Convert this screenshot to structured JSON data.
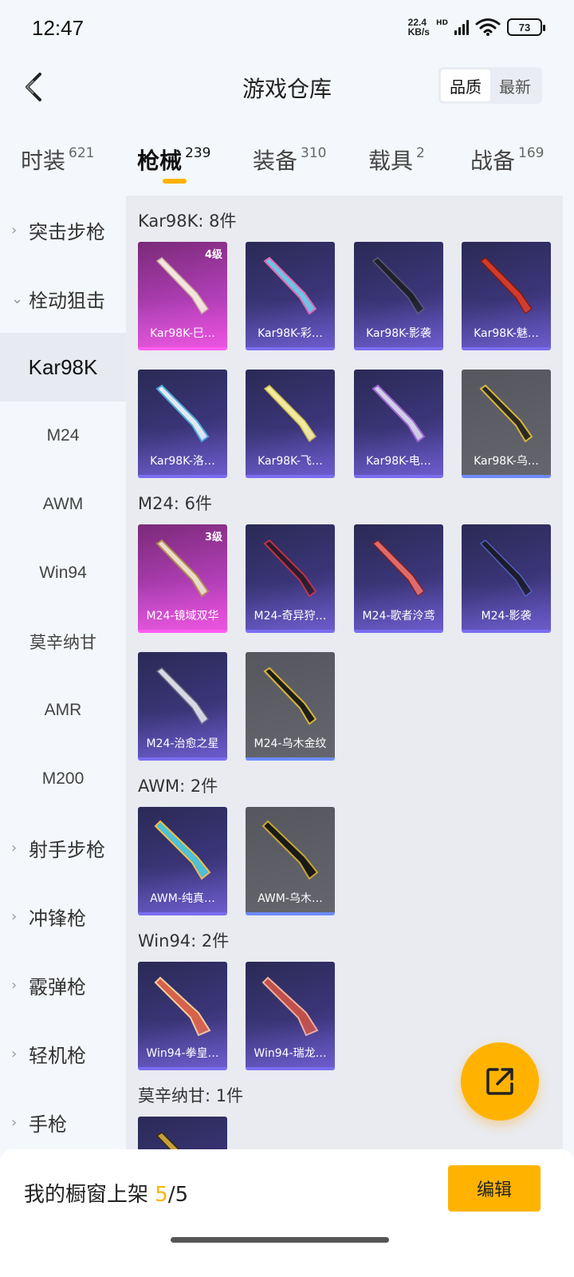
{
  "status": {
    "time": "12:47",
    "net_speed": "22.4",
    "net_unit": "KB/s",
    "hd": "HD",
    "battery": "73"
  },
  "header": {
    "title": "游戏仓库",
    "sort": [
      "品质",
      "最新"
    ]
  },
  "tabs": [
    {
      "label": "时装",
      "count": "621"
    },
    {
      "label": "枪械",
      "count": "239"
    },
    {
      "label": "装备",
      "count": "310"
    },
    {
      "label": "载具",
      "count": "2"
    },
    {
      "label": "战备",
      "count": "169"
    }
  ],
  "sidebar": {
    "groups": [
      "突击步枪",
      "栓动狙击",
      "射手步枪",
      "冲锋枪",
      "霰弹枪",
      "轻机枪",
      "手枪"
    ],
    "subs": [
      "Kar98K",
      "M24",
      "AWM",
      "Win94",
      "莫辛纳甘",
      "AMR",
      "M200"
    ]
  },
  "sections": [
    {
      "title": "Kar98K: 8件",
      "items": [
        {
          "label": "Kar98K-巳…",
          "level": "4级",
          "rarity": "pink"
        },
        {
          "label": "Kar98K-彩…",
          "rarity": "purple"
        },
        {
          "label": "Kar98K-影袭",
          "rarity": "purple"
        },
        {
          "label": "Kar98K-魅…",
          "rarity": "purple"
        },
        {
          "label": "Kar98K-洛…",
          "rarity": "purple"
        },
        {
          "label": "Kar98K-飞…",
          "rarity": "purple"
        },
        {
          "label": "Kar98K-电…",
          "rarity": "purple"
        },
        {
          "label": "Kar98K-乌…",
          "rarity": "gray"
        }
      ]
    },
    {
      "title": "M24: 6件",
      "items": [
        {
          "label": "M24-镜域双华",
          "level": "3级",
          "rarity": "pink"
        },
        {
          "label": "M24-奇异狩…",
          "rarity": "purple"
        },
        {
          "label": "M24-歌者泠鸢",
          "rarity": "purple"
        },
        {
          "label": "M24-影袭",
          "rarity": "purple"
        },
        {
          "label": "M24-治愈之星",
          "rarity": "purple"
        },
        {
          "label": "M24-乌木金纹",
          "rarity": "gray"
        }
      ]
    },
    {
      "title": "AWM: 2件",
      "items": [
        {
          "label": "AWM-纯真…",
          "rarity": "purple"
        },
        {
          "label": "AWM-乌木…",
          "rarity": "gray"
        }
      ]
    },
    {
      "title": "Win94: 2件",
      "items": [
        {
          "label": "Win94-拳皇…",
          "rarity": "purple"
        },
        {
          "label": "Win94-瑞龙…",
          "rarity": "purple"
        }
      ]
    },
    {
      "title": "莫辛纳甘: 1件",
      "items": [
        {
          "label": "",
          "rarity": "purple"
        }
      ]
    }
  ],
  "bottom": {
    "shelf_prefix": "我的橱窗上架 ",
    "shelf_used": "5",
    "shelf_total": "/5",
    "edit": "编辑"
  },
  "colors": {
    "accent": "#ffb300",
    "pink": "#d23fcf",
    "purple": "#3b3578",
    "gray": "#5e5f66"
  }
}
